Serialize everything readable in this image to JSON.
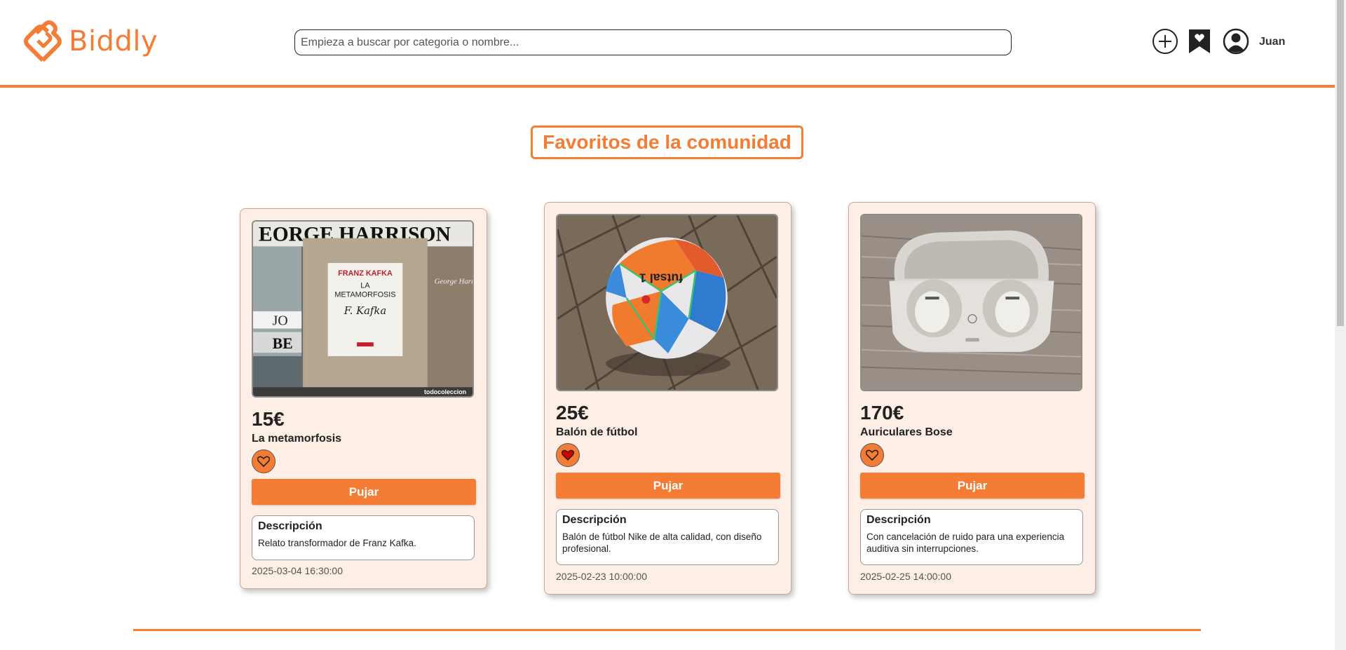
{
  "brand": {
    "name": "Biddly",
    "accent": "#f47c34"
  },
  "search": {
    "placeholder": "Empieza a buscar por categoria o nombre..."
  },
  "header": {
    "user_name": "Juan",
    "icons": [
      "add-icon",
      "favorites-bookmark-icon",
      "user-avatar-icon"
    ]
  },
  "section": {
    "title": "Favoritos de la comunidad"
  },
  "cards": [
    {
      "price": "15€",
      "title": "La metamorfosis",
      "favorited": false,
      "bid_label": "Pujar",
      "desc_title": "Descripción",
      "description": "Relato transformador de Franz Kafka.",
      "date": "2025-03-04 16:30:00",
      "image": {
        "banner": "EORGE HARRISON",
        "author": "FRANZ KAFKA",
        "book_title_1": "LA",
        "book_title_2": "METAMORFOSIS",
        "signature": "F. Kafka",
        "side_left": "JO",
        "side_left_2": "BE",
        "side_right": "George Harrison",
        "watermark": "todocoleccion"
      }
    },
    {
      "price": "25€",
      "title": "Balón de fútbol",
      "favorited": true,
      "bid_label": "Pujar",
      "desc_title": "Descripción",
      "description": "Balón de fútbol Nike de alta calidad, con diseño profesional.",
      "date": "2025-02-23 10:00:00",
      "image": {
        "ball_text": "futsal 1"
      }
    },
    {
      "price": "170€",
      "title": "Auriculares Bose",
      "favorited": false,
      "bid_label": "Pujar",
      "desc_title": "Descripción",
      "description": "Con cancelación de ruido para una experiencia auditiva sin interrupciones.",
      "date": "2025-02-25 14:00:00",
      "image": {}
    }
  ]
}
